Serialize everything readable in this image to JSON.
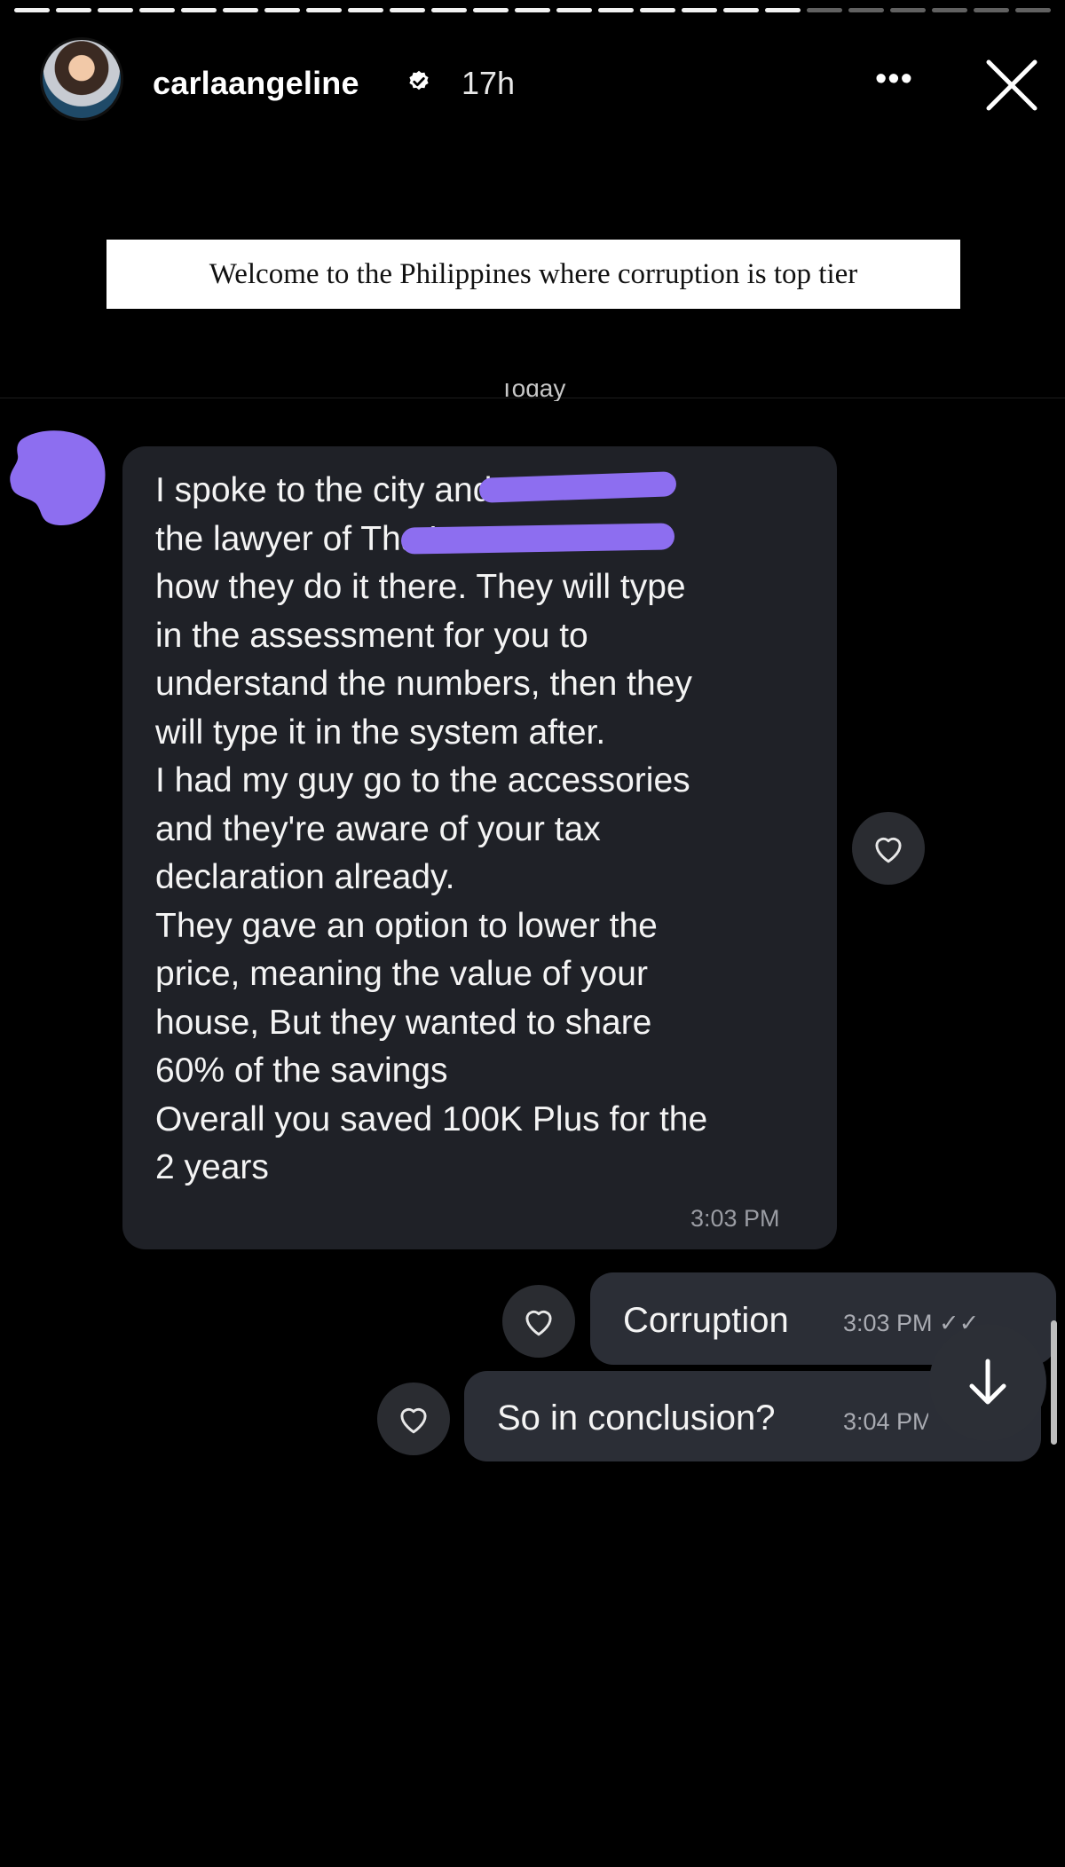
{
  "story": {
    "segments_total": 25,
    "segments_done": 19,
    "username": "carlaangeline",
    "time_ago": "17h",
    "more_icon": "more-horizontal-icon",
    "close_icon": "close-icon",
    "caption": "Welcome to the Philippines where corruption is top tier"
  },
  "chat": {
    "date_divider": "Today",
    "incoming": {
      "text": "I spoke to the city                       and\nthe lawyer of                              That's\nhow they do it there. They will type\nin the assessment for you to\nunderstand the numbers, then they\nwill type it in the system after.\nI had my guy go to the accessories\nand they're aware of your tax\ndeclaration already.\nThey gave an option to lower the\nprice, meaning the value of your\nhouse, But they wanted to share\n60% of the savings\nOverall you saved 100K Plus for the\n2 years",
      "time": "3:03 PM"
    },
    "outgoing": [
      {
        "text": "Corruption",
        "time": "3:03 PM ✓✓"
      },
      {
        "text": "So in conclusion?",
        "time": "3:04 PM"
      }
    ],
    "colors": {
      "incoming_bubble": "#1f2127",
      "outgoing_bubble": "#2b2e36",
      "redaction": "#8d6ef0"
    }
  }
}
